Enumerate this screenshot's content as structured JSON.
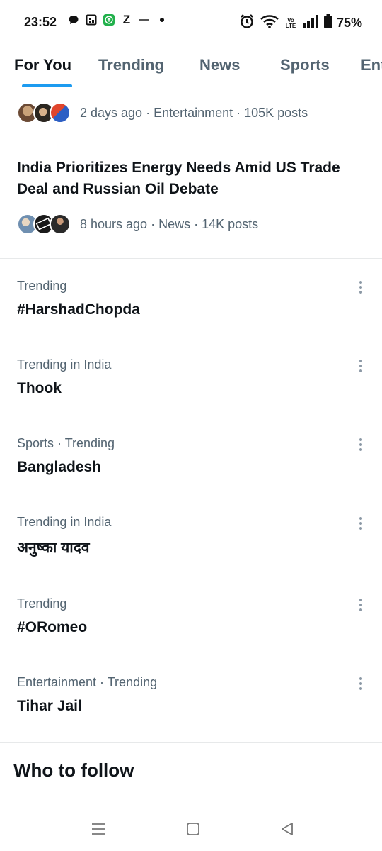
{
  "status_bar": {
    "time": "23:52",
    "battery": "75%",
    "notification_icons": [
      "chat-bubble-icon",
      "grid-app-icon",
      "green-upload-icon",
      "z-app-icon",
      "small-app-icon",
      "dot-icon"
    ],
    "z_label": "Z",
    "volte_top": "Vo",
    "volte_bottom": "LTE"
  },
  "tabs": [
    {
      "label": "For You",
      "active": true
    },
    {
      "label": "Trending",
      "active": false
    },
    {
      "label": "News",
      "active": false
    },
    {
      "label": "Sports",
      "active": false
    },
    {
      "label": "Ent",
      "active": false
    }
  ],
  "stories": [
    {
      "meta": "2 days ago · Entertainment · 105K posts"
    },
    {
      "headline": "India Prioritizes Energy Needs Amid US Trade Deal and Russian Oil Debate",
      "meta": "8 hours ago · News · 14K posts"
    }
  ],
  "trends": [
    {
      "category": "Trending",
      "name": "#HarshadChopda"
    },
    {
      "category": "Trending in India",
      "name": "Thook"
    },
    {
      "category": "Sports · Trending",
      "name": "Bangladesh"
    },
    {
      "category": "Trending in India",
      "name": "अनुष्का यादव"
    },
    {
      "category": "Trending",
      "name": "#ORomeo"
    },
    {
      "category": "Entertainment · Trending",
      "name": "Tihar Jail"
    }
  ],
  "who_to_follow": {
    "title": "Who to follow"
  },
  "colors": {
    "accent": "#1d9bf0",
    "secondary_text": "#536471",
    "primary_text": "#0f1419",
    "divider": "#e7e9ea"
  }
}
